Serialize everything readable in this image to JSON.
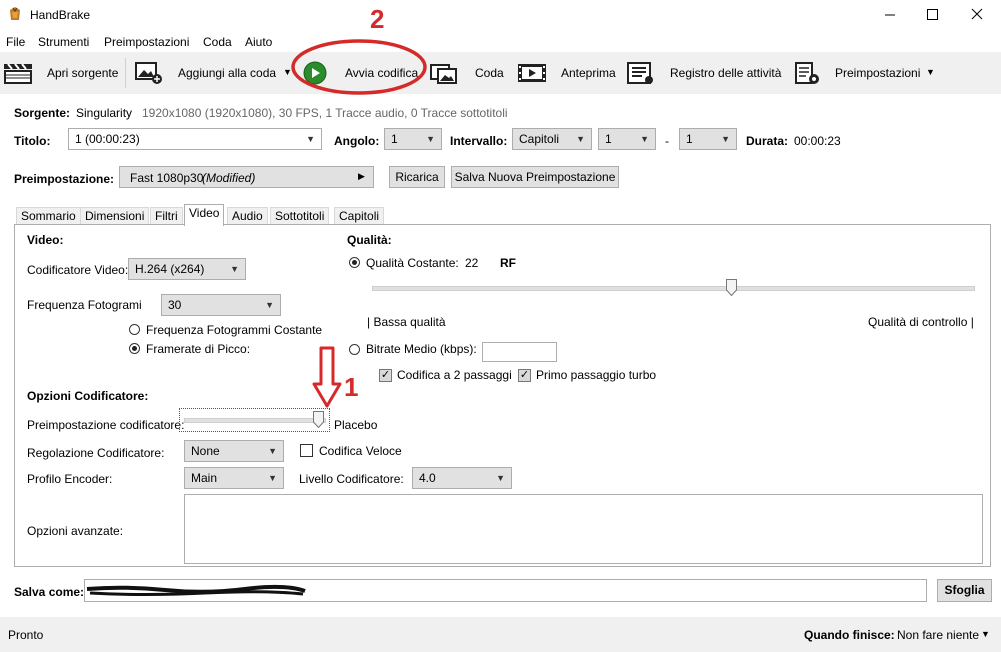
{
  "window": {
    "title": "HandBrake"
  },
  "menu": [
    "File",
    "Strumenti",
    "Preimpostazioni",
    "Coda",
    "Aiuto"
  ],
  "toolbar": {
    "open_source": "Apri sorgente",
    "add_queue": "Aggiungi alla coda",
    "start": "Avvia codifica",
    "queue": "Coda",
    "preview": "Anteprima",
    "activity": "Registro delle attività",
    "presets": "Preimpostazioni"
  },
  "annotations": {
    "num1": "1",
    "num2": "2",
    "color": "#d42a2a"
  },
  "source": {
    "label": "Sorgente:",
    "name": "Singularity",
    "info": "1920x1080 (1920x1080), 30 FPS, 1 Tracce audio, 0 Tracce sottotitoli"
  },
  "title_row": {
    "title_label": "Titolo:",
    "title_value": "1  (00:00:23)",
    "angle_label": "Angolo:",
    "angle_value": "1",
    "range_label": "Intervallo:",
    "range_mode": "Capitoli",
    "range_from": "1",
    "range_sep": "-",
    "range_to": "1",
    "duration_label": "Durata:",
    "duration_value": "00:00:23"
  },
  "preset": {
    "label": "Preimpostazione:",
    "value": "Fast 1080p30",
    "modified": "(Modified)",
    "reload": "Ricarica",
    "save_new": "Salva Nuova Preimpostazione"
  },
  "tabs": [
    "Sommario",
    "Dimensioni",
    "Filtri",
    "Video",
    "Audio",
    "Sottotitoli",
    "Capitoli"
  ],
  "video": {
    "heading": "Video:",
    "encoder_label": "Codificatore Video:",
    "encoder_value": "H.264 (x264)",
    "fps_label": "Frequenza Fotogrami",
    "fps_value": "30",
    "fps_constant": "Frequenza Fotogrammi Costante",
    "fps_peak": "Framerate di Picco:"
  },
  "quality": {
    "heading": "Qualità:",
    "constant_label": "Qualità Costante:",
    "rf_value": "22",
    "rf_unit": "RF",
    "slider_fraction": 0.6,
    "low": "| Bassa qualità",
    "high": "Qualità di controllo |",
    "bitrate_label": "Bitrate Medio (kbps):",
    "two_pass": "Codifica a 2 passaggi",
    "turbo": "Primo passaggio turbo"
  },
  "encoder_opts": {
    "heading": "Opzioni Codificatore:",
    "preset_label": "Preimpostazione codificatore:",
    "preset_value": "Placebo",
    "preset_fraction": 1.0,
    "tune_label": "Regolazione Codificatore:",
    "tune_value": "None",
    "fast_decode": "Codifica Veloce",
    "profile_label": "Profilo Encoder:",
    "profile_value": "Main",
    "level_label": "Livello Codificatore:",
    "level_value": "4.0",
    "advanced_label": "Opzioni avanzate:"
  },
  "save": {
    "label": "Salva come:",
    "browse": "Sfoglia"
  },
  "status": {
    "text": "Pronto",
    "when_done_label": "Quando finisce:",
    "when_done_value": "Non fare niente"
  }
}
